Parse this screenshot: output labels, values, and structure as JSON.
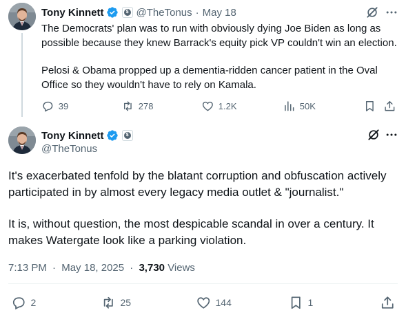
{
  "colors": {
    "verified": "#1d9bf0",
    "text": "#0f1419",
    "secondary": "#536471",
    "line": "#cfd9de"
  },
  "tweet1": {
    "author_name": "Tony Kinnett",
    "handle": "@TheTonus",
    "separator": "·",
    "date": "May 18",
    "paragraphs": [
      "The Democrats' plan was to run with obviously dying Joe Biden as long as possible because they knew Barrack's equity pick VP couldn't win an election.",
      "Pelosi & Obama propped up a dementia-ridden cancer patient in the Oval Office so they wouldn't have to rely on Kamala."
    ],
    "actions": {
      "replies": "39",
      "reposts": "278",
      "likes": "1.2K",
      "views": "50K"
    },
    "icons": [
      "verified-icon",
      "affiliate-badge-icon",
      "grok-icon",
      "more-icon",
      "reply-icon",
      "repost-icon",
      "like-icon",
      "views-icon",
      "bookmark-icon",
      "share-icon"
    ]
  },
  "tweet2": {
    "author_name": "Tony Kinnett",
    "handle": "@TheTonus",
    "paragraphs": [
      "It's exacerbated tenfold by the blatant corruption and obfuscation actively participated in by almost every legacy media outlet & \"journalist.\"",
      "It is, without question, the most despicable scandal in over a century. It makes Watergate look like a parking violation."
    ],
    "time": "7:13 PM",
    "separator": "·",
    "date": "May 18, 2025",
    "views_count": "3,730",
    "views_label": "Views",
    "actions": {
      "replies": "2",
      "reposts": "25",
      "likes": "144",
      "bookmarks": "1"
    }
  }
}
